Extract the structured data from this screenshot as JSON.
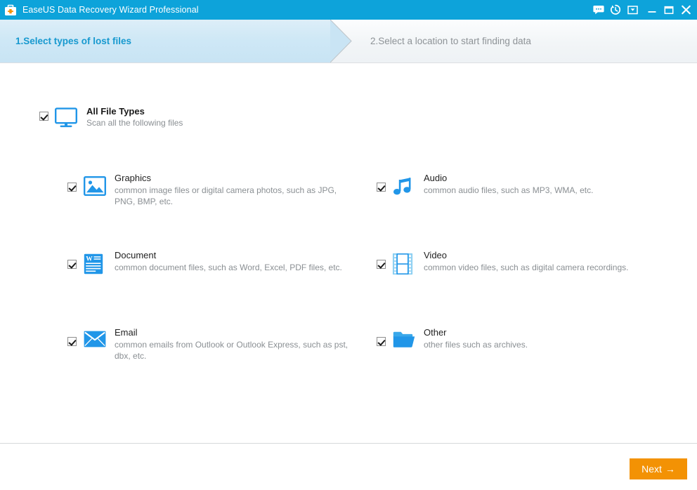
{
  "window": {
    "title": "EaseUS Data Recovery Wizard Professional",
    "app_icon": "first-aid-kit-icon",
    "titlebar_color": "#0da3da",
    "controls": [
      {
        "name": "feedback-chat-icon",
        "glyph": "chat"
      },
      {
        "name": "history-clock-icon",
        "glyph": "clock"
      },
      {
        "name": "updates-box-icon",
        "glyph": "inbox"
      },
      {
        "name": "minimize-button",
        "glyph": "minimize"
      },
      {
        "name": "maximize-button",
        "glyph": "maximize"
      },
      {
        "name": "close-button",
        "glyph": "close"
      }
    ]
  },
  "steps": {
    "step1": {
      "label": "1.Select types of lost files",
      "active": true,
      "color": "#1799cf"
    },
    "step2": {
      "label": "2.Select a location to start finding data",
      "active": false,
      "color": "#8e9397"
    }
  },
  "all_file_types": {
    "title": "All File Types",
    "subtitle": "Scan all the following files",
    "checked": true,
    "icon": "monitor-icon"
  },
  "file_types": [
    {
      "id": "graphics",
      "title": "Graphics",
      "subtitle": "common image files or digital camera photos, such as JPG, PNG, BMP, etc.",
      "checked": true,
      "icon": "image-icon",
      "column": "left",
      "row": 0
    },
    {
      "id": "audio",
      "title": "Audio",
      "subtitle": "common audio files, such as MP3, WMA, etc.",
      "checked": true,
      "icon": "music-note-icon",
      "column": "right",
      "row": 0
    },
    {
      "id": "document",
      "title": "Document",
      "subtitle": "common document files, such as Word, Excel, PDF files, etc.",
      "checked": true,
      "icon": "document-icon",
      "column": "left",
      "row": 1
    },
    {
      "id": "video",
      "title": "Video",
      "subtitle": "common video files, such as digital camera recordings.",
      "checked": true,
      "icon": "film-strip-icon",
      "column": "right",
      "row": 1
    },
    {
      "id": "email",
      "title": "Email",
      "subtitle": "common emails from Outlook or Outlook Express, such as pst, dbx, etc.",
      "checked": true,
      "icon": "envelope-icon",
      "column": "left",
      "row": 2
    },
    {
      "id": "other",
      "title": "Other",
      "subtitle": "other files such as archives.",
      "checked": true,
      "icon": "folder-icon",
      "column": "right",
      "row": 2
    }
  ],
  "footer": {
    "next_label": "Next",
    "next_arrow": "→",
    "next_color": "#f39204"
  },
  "palette": {
    "accent_blue": "#0da3da",
    "icon_blue": "#2196e8",
    "step_active": "#1799cf",
    "step_inactive": "#8e9397",
    "orange": "#f39204",
    "muted_text": "#8a8f93"
  }
}
